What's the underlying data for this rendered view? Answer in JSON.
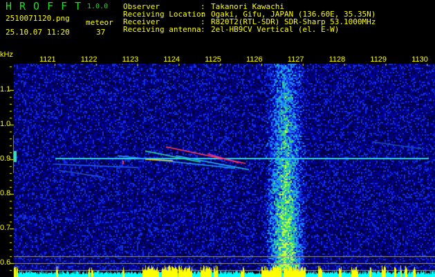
{
  "header": {
    "app_title": "HROFFT",
    "version": "1.0.0",
    "filename": "2510071120.png",
    "datetime": "25.10.07 11:20",
    "meteor_label": "meteor",
    "meteor_count": "37"
  },
  "info": [
    {
      "label": "Observer",
      "value": "Takanori Kawachi"
    },
    {
      "label": "Receiving Location",
      "value": "Ogaki, Gifu, JAPAN (136.60E, 35.35N)"
    },
    {
      "label": "Receiver",
      "value": "R820T2(RTL-SDR) SDR-Sharp 53.1000MHz"
    },
    {
      "label": "Receiving antenna",
      "value": "2el-HB9CV Vertical (el. E-W)"
    }
  ],
  "axes": {
    "y_unit": "kHz",
    "x_ticks": [
      "1121",
      "1122",
      "1123",
      "1124",
      "1125",
      "1126",
      "1127",
      "1128",
      "1129",
      "1130"
    ],
    "y_ticks": [
      "1.1",
      "1.0",
      "0.9",
      "0.8",
      "0.7",
      "0.6"
    ]
  },
  "colors": {
    "text": "#ffff00",
    "title": "#22dd22",
    "histogram": "#ffff00",
    "baseline": "#00ffff"
  }
}
